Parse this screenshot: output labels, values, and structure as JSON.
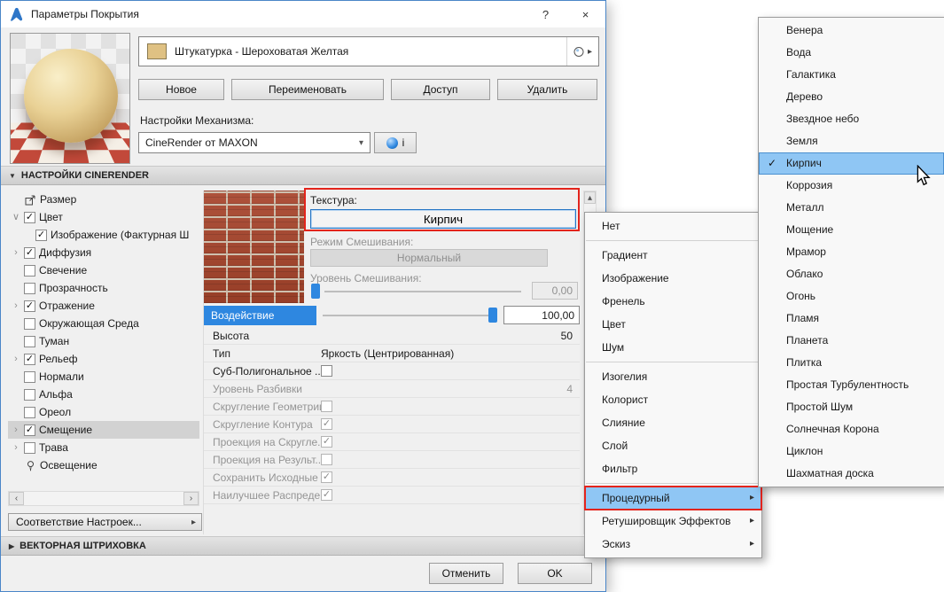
{
  "window": {
    "title": "Параметры Покрытия",
    "help_label": "?",
    "close_label": "×"
  },
  "material": {
    "name": "Штукатурка - Шероховатая Желтая"
  },
  "actions": {
    "new": "Новое",
    "rename": "Переименовать",
    "access": "Доступ",
    "delete": "Удалить"
  },
  "engine": {
    "label": "Настройки Механизма:",
    "value": "CineRender от MAXON",
    "info_label": "i"
  },
  "sections": {
    "cinerender": "НАСТРОЙКИ CINERENDER",
    "vector_hatch": "ВЕКТОРНАЯ ШТРИХОВКА"
  },
  "tree": [
    {
      "label": "Размер",
      "icon": "size-icon"
    },
    {
      "label": "Цвет",
      "check": true,
      "expand": "open"
    },
    {
      "label": "Изображение (Фактурная Ш",
      "check": true,
      "indent": 1
    },
    {
      "label": "Диффузия",
      "check": true,
      "expand": "closed"
    },
    {
      "label": "Свечение",
      "check": false
    },
    {
      "label": "Прозрачность",
      "check": false
    },
    {
      "label": "Отражение",
      "check": true,
      "expand": "closed"
    },
    {
      "label": "Окружающая Среда",
      "check": false
    },
    {
      "label": "Туман",
      "check": false
    },
    {
      "label": "Рельеф",
      "check": true,
      "expand": "closed"
    },
    {
      "label": "Нормали",
      "check": false
    },
    {
      "label": "Альфа",
      "check": false
    },
    {
      "label": "Ореол",
      "check": false
    },
    {
      "label": "Смещение",
      "check": true,
      "expand": "closed",
      "selected": true
    },
    {
      "label": "Трава",
      "check": false,
      "expand": "closed"
    },
    {
      "label": "Освещение",
      "icon": "light-icon"
    }
  ],
  "match_button": "Соответствие Настроек...",
  "displacement": {
    "texture_label": "Текстура:",
    "texture_value": "Кирпич",
    "blend_mode_label": "Режим Смешивания:",
    "blend_mode_value": "Нормальный",
    "blend_level_label": "Уровень Смешивания:",
    "blend_level_value": "0,00",
    "influence_label": "Воздействие",
    "influence_value": "100,00",
    "rows": [
      {
        "label": "Высота",
        "value": "50",
        "align": "right"
      },
      {
        "label": "Тип",
        "value": "Яркость (Центрированная)"
      },
      {
        "label": "Суб-Полигональное ...",
        "checkbox": false
      },
      {
        "label": "Уровень Разбивки",
        "value": "4",
        "align": "right",
        "disabled": true
      },
      {
        "label": "Скругление Геометрии",
        "checkbox": false,
        "disabled": true
      },
      {
        "label": "Скругление Контура",
        "checkbox": true,
        "disabled": true
      },
      {
        "label": "Проекция на Скругле...",
        "checkbox": true,
        "disabled": true
      },
      {
        "label": "Проекция на Результ...",
        "checkbox": false,
        "disabled": true
      },
      {
        "label": "Сохранить Исходные ...",
        "checkbox": true,
        "disabled": true
      },
      {
        "label": "Наилучшее Распреде...",
        "checkbox": true,
        "disabled": true
      }
    ]
  },
  "footer": {
    "cancel": "Отменить",
    "ok": "OK"
  },
  "context_menu": [
    {
      "label": "Нет"
    },
    {
      "separator": true
    },
    {
      "label": "Градиент"
    },
    {
      "label": "Изображение"
    },
    {
      "label": "Френель"
    },
    {
      "label": "Цвет"
    },
    {
      "label": "Шум"
    },
    {
      "separator": true
    },
    {
      "label": "Изогелия"
    },
    {
      "label": "Колорист"
    },
    {
      "label": "Слияние"
    },
    {
      "label": "Слой"
    },
    {
      "label": "Фильтр"
    },
    {
      "separator": true
    },
    {
      "label": "Процедурный",
      "submenu": true,
      "highlighted": true,
      "red_box": true
    },
    {
      "label": "Ретушировщик Эффектов",
      "submenu": true
    },
    {
      "label": "Эскиз",
      "submenu": true
    }
  ],
  "submenu": [
    {
      "label": "Венера"
    },
    {
      "label": "Вода"
    },
    {
      "label": "Галактика"
    },
    {
      "label": "Дерево"
    },
    {
      "label": "Звездное небо"
    },
    {
      "label": "Земля"
    },
    {
      "label": "Кирпич",
      "checked": true,
      "highlighted": true
    },
    {
      "label": "Коррозия"
    },
    {
      "label": "Металл"
    },
    {
      "label": "Мощение"
    },
    {
      "label": "Мрамор"
    },
    {
      "label": "Облако"
    },
    {
      "label": "Огонь"
    },
    {
      "label": "Пламя"
    },
    {
      "label": "Планета"
    },
    {
      "label": "Плитка"
    },
    {
      "label": "Простая Турбулентность"
    },
    {
      "label": "Простой Шум"
    },
    {
      "label": "Солнечная Корона"
    },
    {
      "label": "Циклон"
    },
    {
      "label": "Шахматная доска"
    }
  ],
  "icons": {
    "combo_arrow": "▾",
    "submenu_arrow": "▸",
    "check": "✓",
    "expand_closed": "›",
    "expand_open": "∨",
    "scroll_left": "‹",
    "scroll_right": "›",
    "scroll_up": "▴",
    "scroll_down": "▾",
    "section_open": "▼",
    "section_closed": "▶",
    "match_arrow": "▸",
    "picker_arrow": "▸"
  },
  "colors": {
    "accent": "#2e87e0",
    "sel_border": "#2574c4",
    "menu_hl": "#8fc6f4",
    "ann_red": "#e3241c",
    "swatch": "#dfc183",
    "win_border": "#4a86c8"
  }
}
